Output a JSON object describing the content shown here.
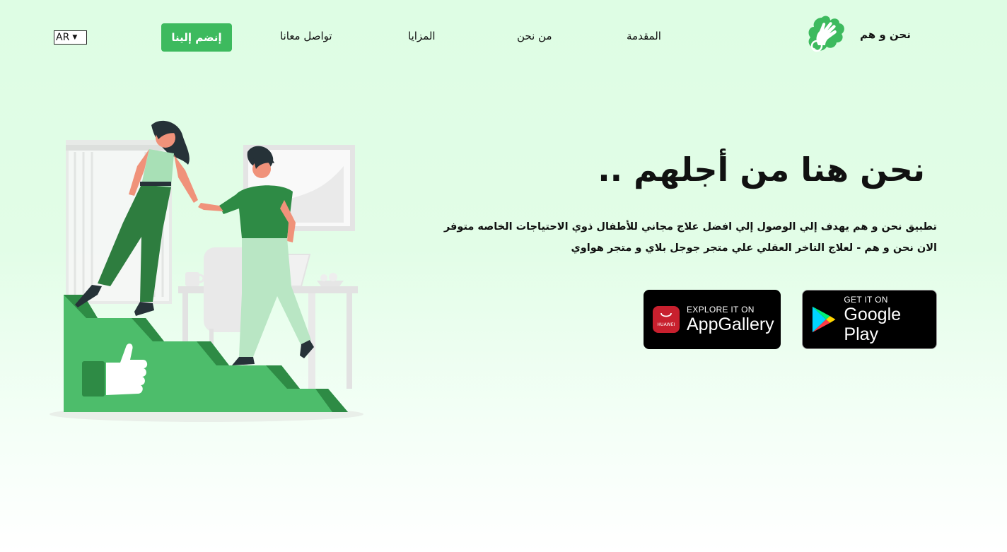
{
  "header": {
    "brand_name": "نحن و هم",
    "nav": {
      "intro": "المقدمة",
      "about": "من نحن",
      "features": "المزايا",
      "contact": "تواصل معانا"
    },
    "join_label": "إنضم إلينا",
    "language": "AR"
  },
  "hero": {
    "title": "نحن هنا من أجلهم ..",
    "description": "تطبيق نحن و هم يهدف إلي الوصول إلي افضل علاج مجاني للأطفال ذوي الاحتياجات الخاصه متوفر الان نحن و هم - لعلاج التاخر العقلي علي متجر جوجل بلاي و متجر هواوي"
  },
  "stores": {
    "google_play": {
      "small": "GET IT ON",
      "big": "Google Play"
    },
    "app_gallery": {
      "small": "EXPLORE IT ON",
      "big": "AppGallery",
      "icon_label": "HUAWEI"
    }
  },
  "colors": {
    "accent": "#3dba5e",
    "background": "#e0fde6",
    "illustration_green": "#2e8b45",
    "illustration_light_green": "#4dbd6b"
  },
  "icons": {
    "brand": "helping-hands-icon",
    "google_play": "google-play-icon",
    "app_gallery": "huawei-appgallery-icon",
    "language_chevron": "chevron-down-icon"
  }
}
